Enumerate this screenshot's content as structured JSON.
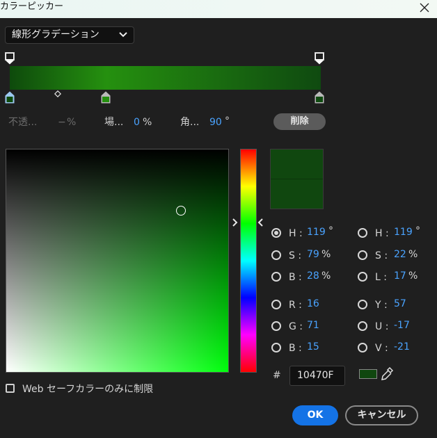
{
  "window": {
    "title": "カラーピッカー"
  },
  "gradient": {
    "type_label": "線形グラデーション",
    "start_color": "#0e4a0c",
    "mid_color": "#25900f",
    "end_color": "#0f4a10"
  },
  "stop_props": {
    "opacity_label": "不透...",
    "opacity_value": "−",
    "opacity_unit": "%",
    "location_label": "場...",
    "location_value": "0",
    "location_unit": "%",
    "angle_label": "角...",
    "angle_value": "90",
    "angle_unit": "°",
    "delete_label": "削除"
  },
  "hsb": {
    "h_label": "H :",
    "h_value": "119",
    "h_unit": "°",
    "s_label": "S :",
    "s_value": "79",
    "s_unit": "%",
    "b_label": "B :",
    "b_value": "28",
    "b_unit": "%"
  },
  "hsl": {
    "h_label": "H :",
    "h_value": "119",
    "h_unit": "°",
    "s_label": "S :",
    "s_value": "22",
    "s_unit": "%",
    "l_label": "L :",
    "l_value": "17",
    "l_unit": "%"
  },
  "rgb": {
    "r_label": "R :",
    "r_value": "16",
    "g_label": "G :",
    "g_value": "71",
    "b_label": "B :",
    "b_value": "15"
  },
  "yuv": {
    "y_label": "Y :",
    "y_value": "57",
    "u_label": "U :",
    "u_value": "-17",
    "v_label": "V :",
    "v_value": "-21"
  },
  "hex": {
    "hash": "#",
    "value": "10470F"
  },
  "current_color": "#10470f",
  "web_safe_label": "Web セーフカラーのみに制限",
  "buttons": {
    "ok": "OK",
    "cancel": "キャンセル"
  }
}
